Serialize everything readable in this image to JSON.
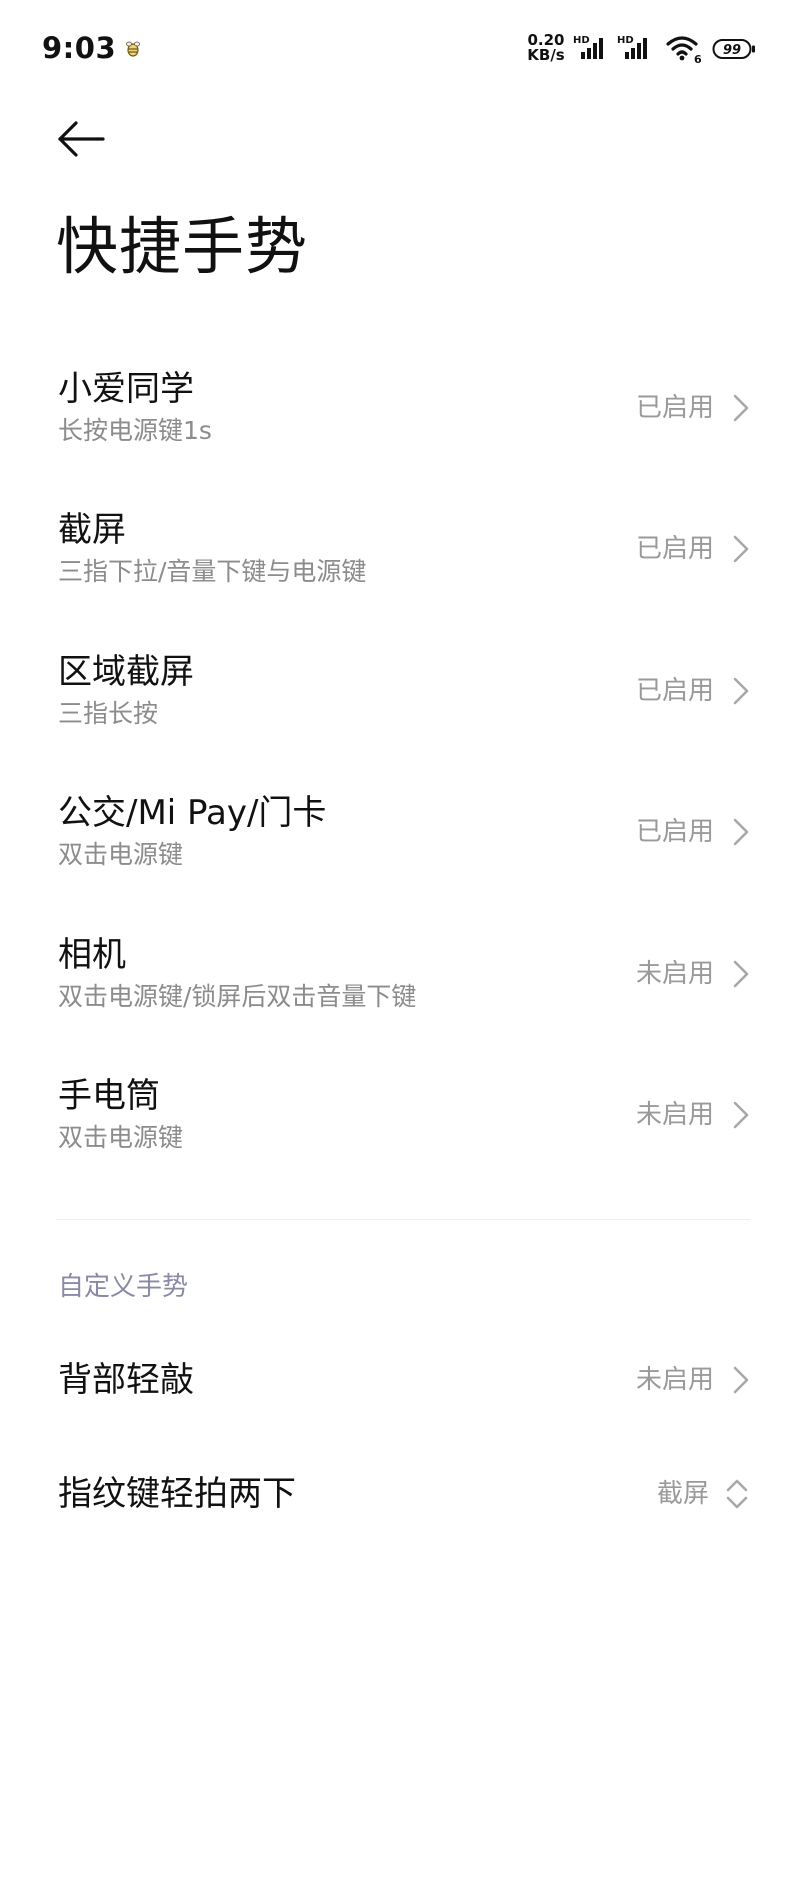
{
  "status_bar": {
    "time": "9:03",
    "net_speed_value": "0.20",
    "net_speed_unit": "KB/s",
    "signal1_label": "HD",
    "signal2_label": "HD",
    "wifi_label": "6",
    "battery_level": "99",
    "icons": [
      "bee-notification-icon",
      "signal-icon",
      "signal-icon",
      "wifi-icon",
      "battery-icon"
    ]
  },
  "header": {
    "title": "快捷手势",
    "back_icon": "back-arrow-icon"
  },
  "gestures": [
    {
      "title": "小爱同学",
      "subtitle": "长按电源键1s",
      "status": "已启用"
    },
    {
      "title": "截屏",
      "subtitle": "三指下拉/音量下键与电源键",
      "status": "已启用"
    },
    {
      "title": "区域截屏",
      "subtitle": "三指长按",
      "status": "已启用"
    },
    {
      "title": "公交/Mi Pay/门卡",
      "subtitle": "双击电源键",
      "status": "已启用"
    },
    {
      "title": "相机",
      "subtitle": "双击电源键/锁屏后双击音量下键",
      "status": "未启用"
    },
    {
      "title": "手电筒",
      "subtitle": "双击电源键",
      "status": "未启用"
    }
  ],
  "custom_section": {
    "header": "自定义手势",
    "items": [
      {
        "title": "背部轻敲",
        "status": "未启用",
        "icon": "chevron-right-icon"
      },
      {
        "title": "指纹键轻拍两下",
        "status": "截屏",
        "icon": "chevron-up-down-icon"
      }
    ]
  },
  "colors": {
    "background": "#ffffff",
    "text_primary": "#111111",
    "text_secondary": "#8c8c8c",
    "status_text": "#9a9a9a",
    "section_header": "#8a8aa8",
    "chevron": "#a8a8a8",
    "divider": "#efefef"
  }
}
